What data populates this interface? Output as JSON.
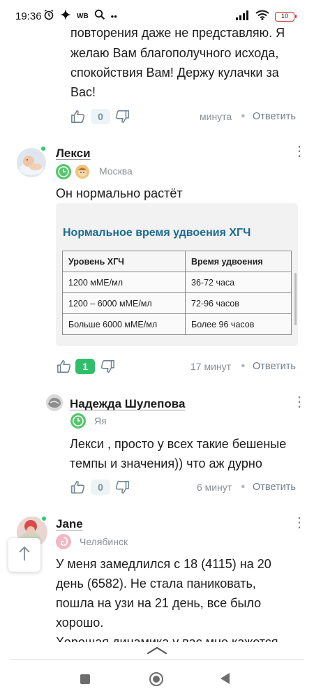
{
  "status_bar": {
    "time": "19:36",
    "left_icons": [
      "alarm-icon",
      "sparkle-icon",
      "wb-icon",
      "search-icon",
      "more-icon"
    ],
    "wb_label": "WB",
    "battery_level": "10"
  },
  "comments": [
    {
      "id": "prev",
      "text_lines": [
        "повторения даже не представляю. Я",
        "желаю Вам благополучного исхода,",
        "спокойствия Вам! Держу кулачки за",
        "Вас!"
      ],
      "votes": "0",
      "time": "минута",
      "reply_label": "Ответить"
    },
    {
      "id": "leksi",
      "author": "Лекси",
      "city": "Москва",
      "text": "Он нормально растёт",
      "votes": "1",
      "time": "17 минут",
      "reply_label": "Ответить",
      "image": {
        "title": "Нормальное время удвоения ХГЧ",
        "headers": [
          "Уровень ХГЧ",
          "Время удвоения"
        ],
        "rows": [
          [
            "1200 мМЕ/мл",
            "36-72 часа"
          ],
          [
            "1200 – 6000 мМЕ/мл",
            "72-96 часов"
          ],
          [
            "Больше 6000 мМЕ/мл",
            "Более 96 часов"
          ]
        ]
      }
    },
    {
      "id": "nadezhda",
      "author": "Надежда Шулепова",
      "city": "Яя",
      "text_lines": [
        "Лекси , просто у всех такие бешеные",
        "темпы и значения)) что аж дурно"
      ],
      "votes": "0",
      "time": "6 минут",
      "reply_label": "Ответить"
    },
    {
      "id": "jane",
      "author": "Jane",
      "city": "Челябинск",
      "text_lines": [
        "У меня замедлился с 18 (4115) на 20",
        "день (6582). Не стала паниковать,",
        "пошла на узи на 21 день, все было",
        "хорошо.",
        "Хорошая динамика у вас мне кажется"
      ]
    }
  ],
  "colors": {
    "accent_green": "#2fbf6b",
    "online_dot": "#2ecc71",
    "table_title": "#1d6a92",
    "meta_grey": "#8a8f96",
    "reply_grey": "#6e7c8c"
  }
}
